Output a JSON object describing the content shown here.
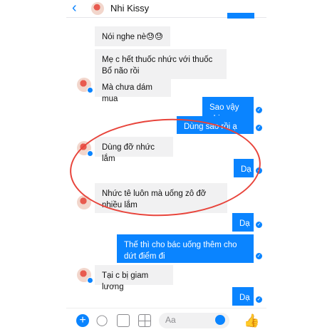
{
  "header": {
    "back_icon": "chevron-left-icon",
    "contact_name": "Nhi Kissy"
  },
  "messages": [
    {
      "from": "them",
      "text": "Nói nghe nè😓😓"
    },
    {
      "from": "them",
      "text": "Mẹ c hết thuốc nhức với thuốc Bổ não rồi"
    },
    {
      "from": "them",
      "text": "Mà chưa dám mua"
    },
    {
      "from": "me",
      "text": "Sao vậy chị"
    },
    {
      "from": "me",
      "text": "Dùng sao rồi ạ"
    },
    {
      "from": "them",
      "text": "Dùng đỡ nhức lắm"
    },
    {
      "from": "me",
      "text": "Dạ"
    },
    {
      "from": "them",
      "text": "Nhức tê luôn mà uống zô đỡ nhiều lắm"
    },
    {
      "from": "me",
      "text": "Dạ"
    },
    {
      "from": "me",
      "text": "Thế thì cho bác uống thêm cho dứt điểm đi"
    },
    {
      "from": "them",
      "text": "Tại c bị giam lương"
    },
    {
      "from": "me",
      "text": "Dạ"
    }
  ],
  "composer": {
    "placeholder": "Aa"
  },
  "colors": {
    "accent": "#0a84ff",
    "incoming_bubble": "#f1f1f2",
    "highlight_circle": "#e8443b"
  }
}
